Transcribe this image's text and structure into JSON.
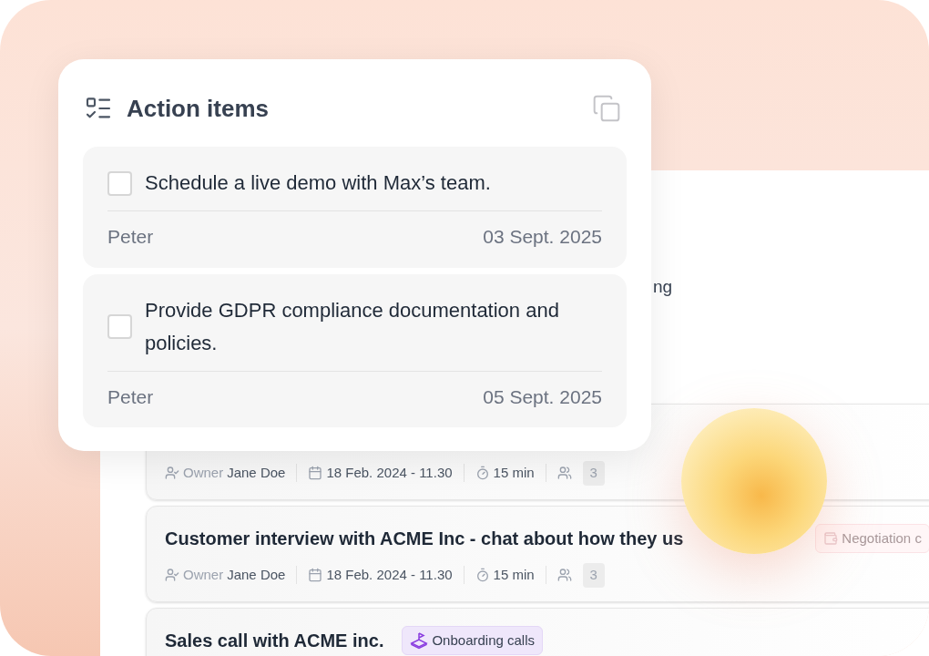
{
  "background_text": "ng",
  "action_items": {
    "title": "Action items",
    "items": [
      {
        "text": "Schedule a live demo with Max’s team.",
        "checked": false,
        "assignee": "Peter",
        "date": "03 Sept. 2025"
      },
      {
        "text": "Provide GDPR compliance documentation and policies.",
        "checked": false,
        "assignee": "Peter",
        "date": "05 Sept. 2025"
      }
    ]
  },
  "meetings": [
    {
      "owner_label": "Owner",
      "owner": "Jane Doe",
      "date": "18 Feb. 2024 - 11.30",
      "duration": "15 min",
      "participants": "3"
    },
    {
      "title": "Customer interview with ACME Inc - chat about how they us",
      "tag": {
        "kind": "negotiation",
        "label": "Negotiation c"
      },
      "owner_label": "Owner",
      "owner": "Jane Doe",
      "date": "18 Feb. 2024 - 11.30",
      "duration": "15 min",
      "participants": "3"
    },
    {
      "title": "Sales call with ACME inc.",
      "tag": {
        "kind": "onboarding",
        "label": "Onboarding calls"
      }
    }
  ]
}
